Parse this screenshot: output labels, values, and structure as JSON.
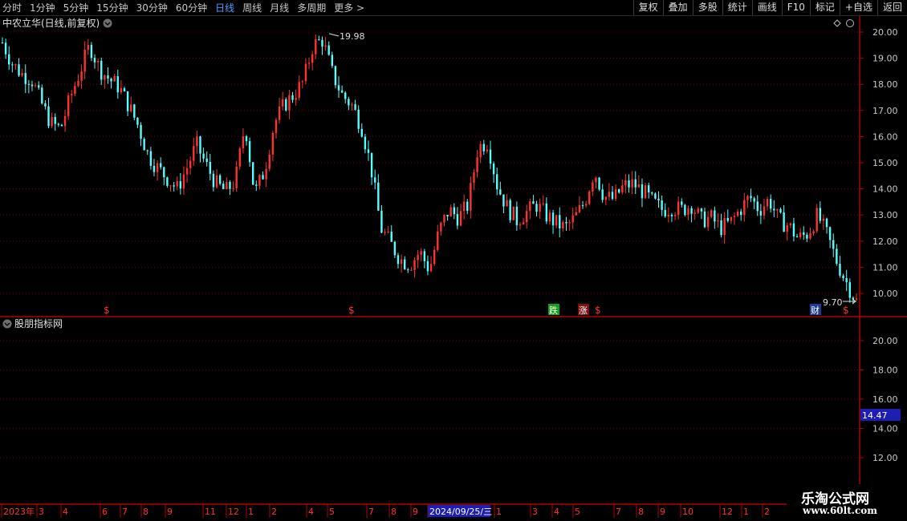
{
  "toolbar": {
    "periods": [
      "分时",
      "1分钟",
      "5分钟",
      "15分钟",
      "30分钟",
      "60分钟",
      "日线",
      "周线",
      "月线",
      "多周期",
      "更多 >"
    ],
    "active_period": "日线",
    "buttons": [
      "复权",
      "叠加",
      "多股",
      "统计",
      "画线",
      "F10",
      "标记",
      "+自选",
      "返回"
    ]
  },
  "main_panel": {
    "title": "中农立华(日线,前复权)",
    "high_label": "19.98",
    "low_label": "9.70",
    "y_ticks": [
      "20.00",
      "19.00",
      "18.00",
      "17.00",
      "16.00",
      "15.00",
      "14.00",
      "13.00",
      "12.00",
      "11.00",
      "10.00"
    ],
    "markers": [
      "$",
      "$",
      "跌",
      "涨",
      "$",
      "财",
      "$"
    ]
  },
  "indicator_panel": {
    "title": "股朋指标网",
    "y_ticks": [
      "20.00",
      "18.00",
      "16.00",
      "14.00",
      "12.00"
    ],
    "current_value": "14.47"
  },
  "time_axis": {
    "labels": [
      "2023年",
      "3",
      "4",
      "6",
      "7",
      "8",
      "9",
      "11",
      "12",
      "1",
      "2",
      "4",
      "5",
      "7",
      "8",
      "9",
      "2024/09/25/三",
      "1",
      "3",
      "4",
      "5",
      "7",
      "8",
      "9",
      "10",
      "12",
      "1",
      "2"
    ]
  },
  "watermark": {
    "line1": "乐淘公式网",
    "line2": "www.60lt.com"
  },
  "colors": {
    "up": "#ff3232",
    "down": "#54ffff",
    "frame": "#b40000",
    "grid": "#6e0000",
    "axis_text": "#c8c8c8",
    "highlight": "#1e1eb4"
  },
  "chart_data": {
    "type": "candlestick",
    "title": "中农立华(日线,前复权)",
    "price_range": [
      9.7,
      19.98
    ],
    "closes": [
      19.6,
      18.8,
      18.4,
      18.2,
      17.3,
      16.5,
      16.3,
      17.5,
      18.5,
      19.5,
      18.6,
      18.2,
      17.9,
      17.2,
      16.4,
      15.3,
      14.8,
      14.4,
      14.0,
      14.8,
      15.7,
      14.9,
      14.2,
      13.9,
      14.3,
      16.5,
      13.8,
      14.7,
      16.5,
      17.2,
      17.6,
      18.1,
      19.5,
      19.7,
      18.4,
      17.6,
      17.2,
      16.4,
      14.8,
      12.5,
      11.9,
      11.3,
      11.1,
      11.6,
      10.9,
      12.4,
      13.2,
      12.9,
      13.4,
      15.6,
      15.8,
      14.1,
      13.3,
      12.8,
      13.1,
      13.4,
      13.0,
      12.7,
      12.5,
      12.9,
      13.5,
      14.7,
      13.7,
      13.6,
      14.1,
      14.2,
      13.9,
      13.5,
      13.2,
      13.3,
      13.2,
      13.4,
      12.8,
      12.9,
      12.5,
      12.7,
      13.2,
      13.7,
      13.2,
      13.6,
      12.8,
      12.6,
      12.1,
      12.3,
      13.0,
      12.2,
      11.2,
      10.4,
      9.7
    ],
    "high_marker": 19.98,
    "low_marker": 9.7,
    "y_axis_ticks": [
      10,
      11,
      12,
      13,
      14,
      15,
      16,
      17,
      18,
      19,
      20
    ],
    "indicator_value": 14.47,
    "indicator_y_ticks": [
      12,
      14,
      16,
      18,
      20
    ]
  }
}
